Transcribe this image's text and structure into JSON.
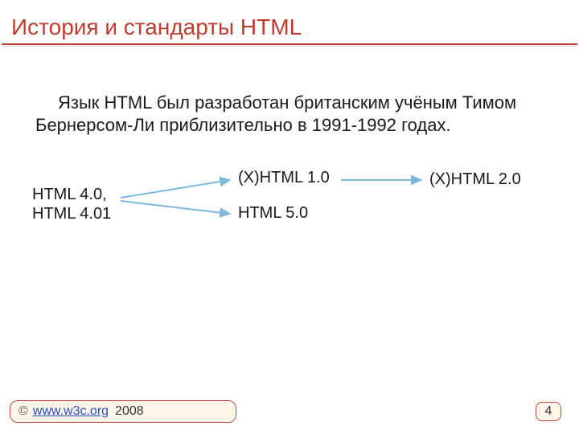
{
  "title": "История и стандарты HTML",
  "body": "Язык HTML был разработан британским учёным Тимом Бернерсом-Ли приблизительно в 1991-1992 годах.",
  "diagram": {
    "n1": "HTML 4.0,\nHTML 4.01",
    "n2": "(X)HTML 1.0",
    "n3": "HTML 5.0",
    "n4": "(X)HTML 2.0"
  },
  "footer": {
    "copyright": "©",
    "link_text": "www.w3c.org",
    "year": "2008"
  },
  "page_number": "4",
  "colors": {
    "accent": "#c13b2f",
    "arrow": "#7fb8d8",
    "footer_bg": "#fef6eb"
  }
}
